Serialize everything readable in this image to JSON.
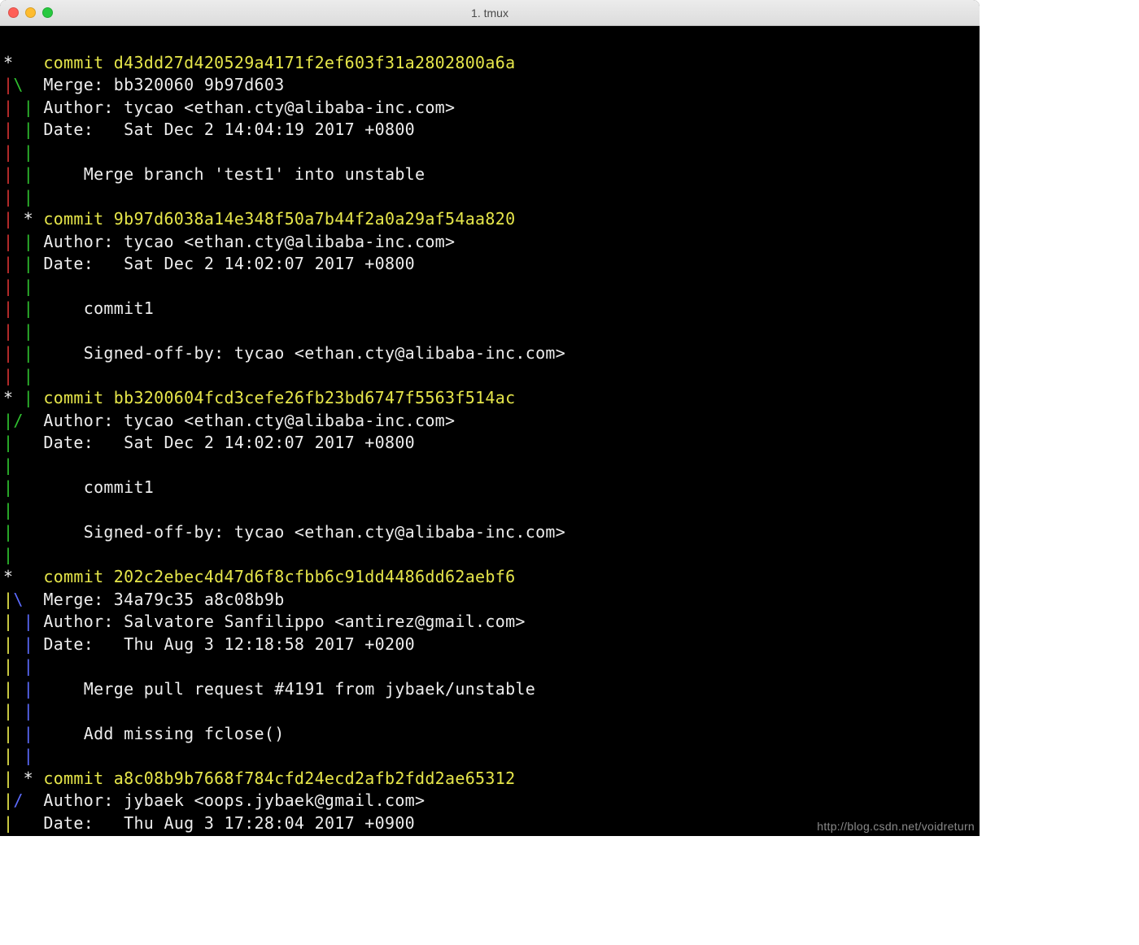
{
  "title": "1. tmux",
  "watermark": "http://blog.csdn.net/voidreturn",
  "commits": [
    {
      "hash": "d43dd27d420529a4171f2ef603f31a2802800a6a",
      "merge": "bb320060 9b97d603",
      "author": "tycao <ethan.cty@alibaba-inc.com>",
      "date": "Sat Dec 2 14:04:19 2017 +0800",
      "message": [
        "Merge branch 'test1' into unstable"
      ]
    },
    {
      "hash": "9b97d6038a14e348f50a7b44f2a0a29af54aa820",
      "author": "tycao <ethan.cty@alibaba-inc.com>",
      "date": "Sat Dec 2 14:02:07 2017 +0800",
      "message": [
        "commit1",
        "",
        "Signed-off-by: tycao <ethan.cty@alibaba-inc.com>"
      ]
    },
    {
      "hash": "bb3200604fcd3cefe26fb23bd6747f5563f514ac",
      "author": "tycao <ethan.cty@alibaba-inc.com>",
      "date": "Sat Dec 2 14:02:07 2017 +0800",
      "message": [
        "commit1",
        "",
        "Signed-off-by: tycao <ethan.cty@alibaba-inc.com>"
      ]
    },
    {
      "hash": "202c2ebec4d47d6f8cfbb6c91dd4486dd62aebf6",
      "merge": "34a79c35 a8c08b9b",
      "author": "Salvatore Sanfilippo <antirez@gmail.com>",
      "date": "Thu Aug 3 12:18:58 2017 +0200",
      "message": [
        "Merge pull request #4191 from jybaek/unstable",
        "",
        "Add missing fclose()"
      ]
    },
    {
      "hash": "a8c08b9b7668f784cfd24ecd2afb2fdd2ae65312",
      "author": "jybaek <oops.jybaek@gmail.com>",
      "date": "Thu Aug 3 17:28:04 2017 +0900",
      "message": []
    }
  ],
  "labels": {
    "commit": "commit",
    "merge": "Merge:",
    "author": "Author:",
    "date": "Date:"
  }
}
